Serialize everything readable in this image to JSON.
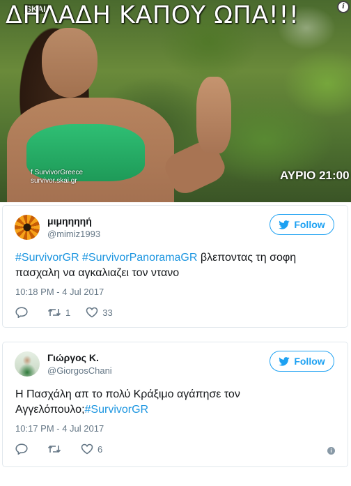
{
  "image": {
    "caption": "ΔΗΛΑΔΗ ΚΑΠΟΥ ΩΠΑ!!!",
    "channel_logo": "SKAI",
    "watermark_line1": "SurvivorGreece",
    "watermark_line2": "survivor.skai.gr",
    "airtime": "ΑΥΡΙΟ 21:00"
  },
  "tweets": [
    {
      "name": "μιμηηηηή",
      "handle": "@mimiz1993",
      "follow_label": "Follow",
      "text_parts": [
        "#SurvivorGR",
        " ",
        "#SurvivorPanoramaGR",
        " βλεποντας τη σοφη πασχαλη να αγκαλιαζει τον ντανο"
      ],
      "timestamp": "10:18 PM - 4 Jul 2017",
      "retweets": "1",
      "likes": "33"
    },
    {
      "name": "Γιώργος Κ.",
      "handle": "@GiorgosChani",
      "follow_label": "Follow",
      "text_parts": [
        "Η Πασχάλη απ το πολύ Κράξιμο αγάπησε τον Αγγελόπουλο;",
        "#SurvivorGR"
      ],
      "timestamp": "10:17 PM - 4 Jul 2017",
      "retweets": "",
      "likes": "6"
    }
  ],
  "colors": {
    "twitter_blue": "#1da1f2",
    "hashtag": "#1b95e0",
    "muted": "#657786"
  }
}
